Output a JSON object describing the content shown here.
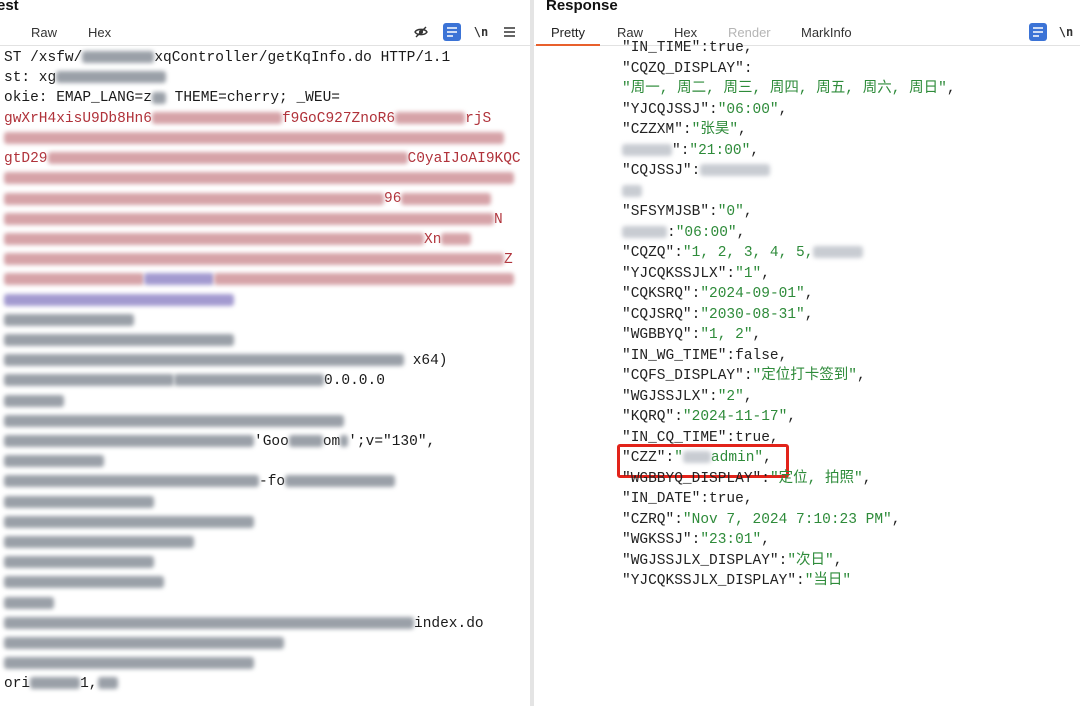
{
  "request": {
    "title": "est",
    "tabs": [
      {
        "label": "Raw"
      },
      {
        "label": "Hex"
      }
    ],
    "tool_newline": "\\n",
    "lines": [
      {
        "segments": [
          {
            "t": "ST /xsfw/"
          },
          {
            "blur": 72,
            "c": "gray"
          },
          {
            "t": "xqController/getKqInfo.do HTTP/1.1"
          }
        ]
      },
      {
        "segments": [
          {
            "t": "st: xg"
          },
          {
            "blur": 110,
            "c": "gray"
          }
        ]
      },
      {
        "segments": [
          {
            "t": "okie: EMAP_LANG=z"
          },
          {
            "blur": 14,
            "c": "gray"
          },
          {
            "t": " THEME=cherry; _WEU="
          }
        ]
      },
      {
        "red": true,
        "segments": [
          {
            "t": "gwXrH4xisU9Db8Hn6"
          },
          {
            "blur": 130,
            "c": "pink"
          },
          {
            "t": "f9GoC927ZnoR6"
          },
          {
            "blur": 70,
            "c": "pink"
          },
          {
            "t": "rjS"
          }
        ]
      },
      {
        "red": true,
        "segments": [
          {
            "blur": 500,
            "c": "pink"
          }
        ]
      },
      {
        "red": true,
        "segments": [
          {
            "t": "gtD29"
          },
          {
            "blur": 360,
            "c": "pink"
          },
          {
            "t": "C0yaIJoAI9KQC"
          }
        ]
      },
      {
        "red": true,
        "segments": [
          {
            "blur": 510,
            "c": "pink"
          }
        ]
      },
      {
        "red": true,
        "segments": [
          {
            "blur": 380,
            "c": "pink"
          },
          {
            "t": "96"
          },
          {
            "blur": 90,
            "c": "pink"
          }
        ]
      },
      {
        "red": true,
        "segments": [
          {
            "blur": 490,
            "c": "pink"
          },
          {
            "t": "N"
          }
        ]
      },
      {
        "red": true,
        "segments": [
          {
            "blur": 420,
            "c": "pink"
          },
          {
            "t": "Xn"
          },
          {
            "blur": 30,
            "c": "pink"
          }
        ]
      },
      {
        "red": true,
        "segments": [
          {
            "blur": 500,
            "c": "pink"
          },
          {
            "t": "Z"
          }
        ]
      },
      {
        "red": true,
        "segments": [
          {
            "blur": 140,
            "c": "pink"
          },
          {
            "blur": 70,
            "c": "purple"
          },
          {
            "blur": 300,
            "c": "pink"
          }
        ]
      },
      {
        "segments": [
          {
            "blur": 230,
            "c": "purple"
          }
        ]
      },
      {
        "segments": [
          {
            "blur": 130,
            "c": "gray"
          }
        ]
      },
      {
        "segments": [
          {
            "blur": 230,
            "c": "gray"
          }
        ]
      },
      {
        "segments": [
          {
            "blur": 400,
            "c": "gray"
          },
          {
            "t": " x64)"
          }
        ]
      },
      {
        "segments": [
          {
            "blur": 170,
            "c": "gray"
          },
          {
            "blur": 150,
            "c": "gray"
          },
          {
            "t": "0.0.0.0"
          }
        ]
      },
      {
        "segments": [
          {
            "blur": 60,
            "c": "gray"
          }
        ]
      },
      {
        "segments": [
          {
            "blur": 340,
            "c": "gray"
          }
        ]
      },
      {
        "segments": [
          {
            "blur": 250,
            "c": "gray"
          },
          {
            "t": "'Goo"
          },
          {
            "blur": 34,
            "c": "gray"
          },
          {
            "t": "om"
          },
          {
            "blur": 8,
            "c": "gray"
          },
          {
            "t": "';v=\"130\","
          }
        ]
      },
      {
        "segments": [
          {
            "blur": 100,
            "c": "gray"
          }
        ]
      },
      {
        "segments": [
          {
            "blur": 255,
            "c": "gray"
          },
          {
            "t": "-fo"
          },
          {
            "blur": 110,
            "c": "gray"
          }
        ]
      },
      {
        "segments": [
          {
            "blur": 150,
            "c": "gray"
          }
        ]
      },
      {
        "segments": [
          {
            "blur": 250,
            "c": "gray"
          }
        ]
      },
      {
        "segments": [
          {
            "blur": 190,
            "c": "gray"
          }
        ]
      },
      {
        "segments": [
          {
            "blur": 150,
            "c": "gray"
          }
        ]
      },
      {
        "segments": [
          {
            "blur": 160,
            "c": "gray"
          }
        ]
      },
      {
        "segments": [
          {
            "blur": 50,
            "c": "gray"
          }
        ]
      },
      {
        "segments": [
          {
            "blur": 410,
            "c": "gray"
          },
          {
            "t": "index.do"
          }
        ]
      },
      {
        "segments": [
          {
            "blur": 280,
            "c": "gray"
          }
        ]
      },
      {
        "segments": [
          {
            "blur": 250,
            "c": "gray"
          }
        ]
      },
      {
        "segments": [
          {
            "t": "ori"
          },
          {
            "blur": 50,
            "c": "gray"
          },
          {
            "t": "1,"
          },
          {
            "blur": 20,
            "c": "gray"
          }
        ]
      }
    ]
  },
  "response": {
    "title": "Response",
    "tabs": [
      {
        "label": "Pretty",
        "active": true
      },
      {
        "label": "Raw"
      },
      {
        "label": "Hex"
      },
      {
        "label": "Render",
        "disabled": true
      },
      {
        "label": "MarkInfo"
      }
    ],
    "tool_newline": "\\n",
    "lines": [
      {
        "segments": [
          {
            "k": "\"IN_TIME\""
          },
          {
            "l": ":true,"
          }
        ]
      },
      {
        "segments": [
          {
            "k": "\"CQZQ_DISPLAY\""
          },
          {
            "l": ":"
          }
        ]
      },
      {
        "segments": [
          {
            "s": "\"周一, 周二, 周三, 周四, 周五, 周六, 周日\""
          },
          {
            "l": ","
          }
        ]
      },
      {
        "segments": [
          {
            "k": "\"YJCQJSSJ\""
          },
          {
            "l": ":"
          },
          {
            "s": "\"06:00\""
          },
          {
            "l": ","
          }
        ]
      },
      {
        "segments": [
          {
            "k": "\"CZZXM\""
          },
          {
            "l": ":"
          },
          {
            "s": "\"张昊\""
          },
          {
            "l": ","
          }
        ]
      },
      {
        "segments": [
          {
            "blur": 50,
            "c": "light"
          },
          {
            "k": "\""
          },
          {
            "l": ":"
          },
          {
            "s": "\"21:00\""
          },
          {
            "l": ","
          }
        ]
      },
      {
        "segments": [
          {
            "k": "\"CQJSSJ\""
          },
          {
            "l": ":"
          },
          {
            "blur": 70,
            "c": "light"
          }
        ]
      },
      {
        "segments": [
          {
            "blur": 20,
            "c": "light"
          }
        ]
      },
      {
        "segments": [
          {
            "k": "\"SFSYMJSB\""
          },
          {
            "l": ":"
          },
          {
            "s": "\"0\""
          },
          {
            "l": ","
          }
        ]
      },
      {
        "segments": [
          {
            "blur": 45,
            "c": "light"
          },
          {
            "l": ":"
          },
          {
            "s": "\"06:00\""
          },
          {
            "l": ","
          }
        ]
      },
      {
        "segments": [
          {
            "k": "\"CQZQ\""
          },
          {
            "l": ":"
          },
          {
            "s": "\"1, 2, 3, 4, 5,"
          },
          {
            "blur": 50,
            "c": "light"
          }
        ]
      },
      {
        "segments": [
          {
            "k": "\"YJCQKSSJLX\""
          },
          {
            "l": ":"
          },
          {
            "s": "\"1\""
          },
          {
            "l": ","
          }
        ]
      },
      {
        "segments": [
          {
            "k": "\"CQKSRQ\""
          },
          {
            "l": ":"
          },
          {
            "s": "\"2024-09-01\""
          },
          {
            "l": ","
          }
        ]
      },
      {
        "segments": [
          {
            "k": "\"CQJSRQ\""
          },
          {
            "l": ":"
          },
          {
            "s": "\"2030-08-31\""
          },
          {
            "l": ","
          }
        ]
      },
      {
        "segments": [
          {
            "k": "\"WGBBYQ\""
          },
          {
            "l": ":"
          },
          {
            "s": "\"1, 2\""
          },
          {
            "l": ","
          }
        ]
      },
      {
        "segments": [
          {
            "k": "\"IN_WG_TIME\""
          },
          {
            "l": ":false,"
          }
        ]
      },
      {
        "segments": [
          {
            "k": "\"CQFS_DISPLAY\""
          },
          {
            "l": ":"
          },
          {
            "s": "\"定位打卡签到\""
          },
          {
            "l": ","
          }
        ]
      },
      {
        "segments": [
          {
            "k": "\"WGJSSJLX\""
          },
          {
            "l": ":"
          },
          {
            "s": "\"2\""
          },
          {
            "l": ","
          }
        ]
      },
      {
        "segments": [
          {
            "k": "\"KQRQ\""
          },
          {
            "l": ":"
          },
          {
            "s": "\"2024-11-17\""
          },
          {
            "l": ","
          }
        ]
      },
      {
        "segments": [
          {
            "k": "\"IN_CQ_TIME\""
          },
          {
            "l": ":true,"
          }
        ]
      },
      {
        "segments": [
          {
            "k": "\"CZZ\""
          },
          {
            "l": ":"
          },
          {
            "s": "\""
          },
          {
            "blur": 28,
            "c": "light"
          },
          {
            "s": "admin\""
          },
          {
            "l": ","
          }
        ]
      },
      {
        "segments": [
          {
            "k": "\"WGBBYQ_DISPLAY\""
          },
          {
            "l": ":"
          },
          {
            "s": "\"定位, 拍照\""
          },
          {
            "l": ","
          }
        ]
      },
      {
        "segments": [
          {
            "k": "\"IN_DATE\""
          },
          {
            "l": ":true,"
          }
        ]
      },
      {
        "segments": [
          {
            "k": "\"CZRQ\""
          },
          {
            "l": ":"
          },
          {
            "s": "\"Nov 7, 2024 7:10:23 PM\""
          },
          {
            "l": ","
          }
        ]
      },
      {
        "segments": [
          {
            "k": "\"WGKSSJ\""
          },
          {
            "l": ":"
          },
          {
            "s": "\"23:01\""
          },
          {
            "l": ","
          }
        ]
      },
      {
        "segments": [
          {
            "k": "\"WGJSSJLX_DISPLAY\""
          },
          {
            "l": ":"
          },
          {
            "s": "\"次日\""
          },
          {
            "l": ","
          }
        ]
      },
      {
        "segments": [
          {
            "k": "\"YJCQKSSJLX_DISPLAY\""
          },
          {
            "l": ":"
          },
          {
            "s": "\"当日\""
          }
        ]
      }
    ]
  },
  "colors": {
    "accent_tab": "#e8602c",
    "highlight_box": "#e2231a",
    "json_string": "#2e8b3a",
    "request_cookie": "#b0323a"
  }
}
